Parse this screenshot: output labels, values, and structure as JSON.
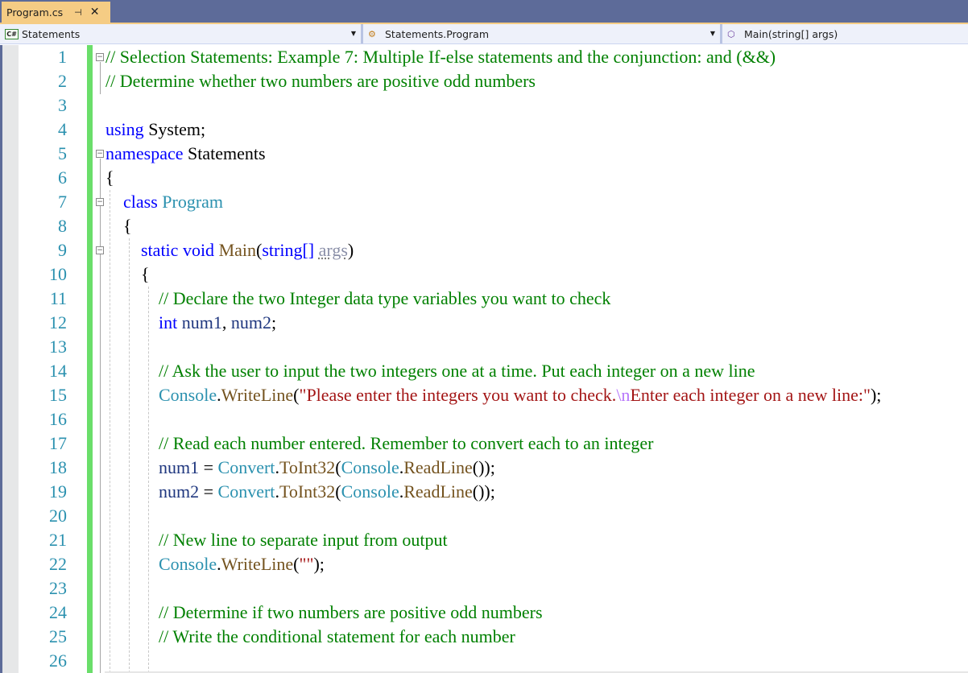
{
  "tab": {
    "title": "Program.cs",
    "pin_icon": "pin-icon",
    "close_icon": "close-icon"
  },
  "navbar": {
    "project": "Statements",
    "type": "Statements.Program",
    "member": "Main(string[] args)"
  },
  "colors": {
    "comment": "#008000",
    "keyword": "#0000ff",
    "type": "#2b91af",
    "method": "#74531f",
    "variable": "#1f377f",
    "string": "#a31515",
    "escape": "#b776fb",
    "line_number": "#2b91af",
    "change_bar": "#6ade6a",
    "tab_active": "#f5cc84"
  },
  "line_numbers": [
    "1",
    "2",
    "3",
    "4",
    "5",
    "6",
    "7",
    "8",
    "9",
    "10",
    "11",
    "12",
    "13",
    "14",
    "15",
    "16",
    "17",
    "18",
    "19",
    "20",
    "21",
    "22",
    "23",
    "24",
    "25",
    "26"
  ],
  "code": {
    "l1": "// Selection Statements: Example 7: Multiple If-else statements and the conjunction: and (&&)",
    "l2": "// Determine whether two numbers are positive odd numbers",
    "l4_kw": "using",
    "l4_rest": " System;",
    "l5_kw": "namespace",
    "l5_rest": " Statements",
    "l6": "{",
    "l7_kw": "class",
    "l7_type": "Program",
    "l8": "{",
    "l9_kw1": "static",
    "l9_kw2": "void",
    "l9_method": "Main",
    "l9_kw3": "string",
    "l9_param": "args",
    "l10": "{",
    "l11": "// Declare the two Integer data type variables you want to check",
    "l12_kw": "int",
    "l12_v1": "num1",
    "l12_v2": "num2",
    "l14": "// Ask the user to input the two integers one at a time. Put each integer on a new line",
    "l15_type": "Console",
    "l15_method": "WriteLine",
    "l15_str1": "\"Please enter the integers you want to check.",
    "l15_esc": "\\n",
    "l15_str2": "Enter each integer on a new line:\"",
    "l17": "// Read each number entered. Remember to convert each to an integer",
    "l18_var": "num1",
    "l19_var": "num2",
    "conv_type": "Convert",
    "conv_method": "ToInt32",
    "console_type": "Console",
    "readline_method": "ReadLine",
    "l21": "// New line to separate input from output",
    "l22_type": "Console",
    "l22_method": "WriteLine",
    "l22_str": "\"\"",
    "l24": "// Determine if two numbers are positive odd numbers",
    "l25": "// Write the conditional statement for each number"
  }
}
